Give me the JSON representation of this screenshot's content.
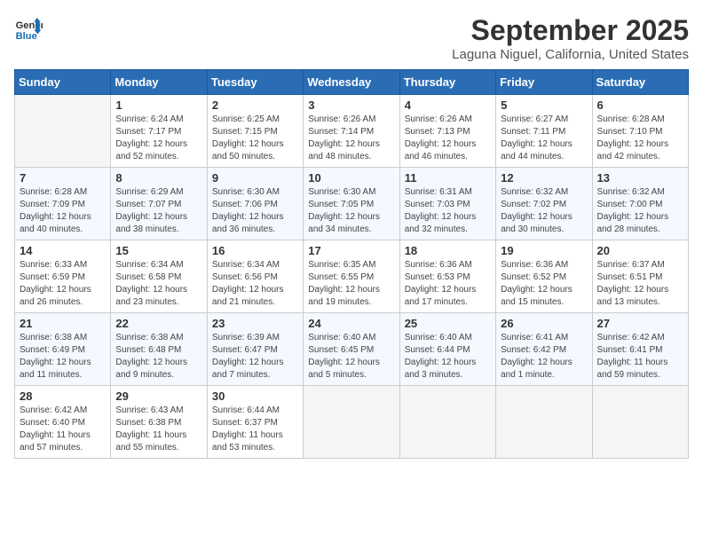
{
  "header": {
    "logo_line1": "General",
    "logo_line2": "Blue",
    "month": "September 2025",
    "location": "Laguna Niguel, California, United States"
  },
  "weekdays": [
    "Sunday",
    "Monday",
    "Tuesday",
    "Wednesday",
    "Thursday",
    "Friday",
    "Saturday"
  ],
  "weeks": [
    [
      {
        "day": null
      },
      {
        "day": "1",
        "sunrise": "6:24 AM",
        "sunset": "7:17 PM",
        "daylight": "12 hours and 52 minutes."
      },
      {
        "day": "2",
        "sunrise": "6:25 AM",
        "sunset": "7:15 PM",
        "daylight": "12 hours and 50 minutes."
      },
      {
        "day": "3",
        "sunrise": "6:26 AM",
        "sunset": "7:14 PM",
        "daylight": "12 hours and 48 minutes."
      },
      {
        "day": "4",
        "sunrise": "6:26 AM",
        "sunset": "7:13 PM",
        "daylight": "12 hours and 46 minutes."
      },
      {
        "day": "5",
        "sunrise": "6:27 AM",
        "sunset": "7:11 PM",
        "daylight": "12 hours and 44 minutes."
      },
      {
        "day": "6",
        "sunrise": "6:28 AM",
        "sunset": "7:10 PM",
        "daylight": "12 hours and 42 minutes."
      }
    ],
    [
      {
        "day": "7",
        "sunrise": "6:28 AM",
        "sunset": "7:09 PM",
        "daylight": "12 hours and 40 minutes."
      },
      {
        "day": "8",
        "sunrise": "6:29 AM",
        "sunset": "7:07 PM",
        "daylight": "12 hours and 38 minutes."
      },
      {
        "day": "9",
        "sunrise": "6:30 AM",
        "sunset": "7:06 PM",
        "daylight": "12 hours and 36 minutes."
      },
      {
        "day": "10",
        "sunrise": "6:30 AM",
        "sunset": "7:05 PM",
        "daylight": "12 hours and 34 minutes."
      },
      {
        "day": "11",
        "sunrise": "6:31 AM",
        "sunset": "7:03 PM",
        "daylight": "12 hours and 32 minutes."
      },
      {
        "day": "12",
        "sunrise": "6:32 AM",
        "sunset": "7:02 PM",
        "daylight": "12 hours and 30 minutes."
      },
      {
        "day": "13",
        "sunrise": "6:32 AM",
        "sunset": "7:00 PM",
        "daylight": "12 hours and 28 minutes."
      }
    ],
    [
      {
        "day": "14",
        "sunrise": "6:33 AM",
        "sunset": "6:59 PM",
        "daylight": "12 hours and 26 minutes."
      },
      {
        "day": "15",
        "sunrise": "6:34 AM",
        "sunset": "6:58 PM",
        "daylight": "12 hours and 23 minutes."
      },
      {
        "day": "16",
        "sunrise": "6:34 AM",
        "sunset": "6:56 PM",
        "daylight": "12 hours and 21 minutes."
      },
      {
        "day": "17",
        "sunrise": "6:35 AM",
        "sunset": "6:55 PM",
        "daylight": "12 hours and 19 minutes."
      },
      {
        "day": "18",
        "sunrise": "6:36 AM",
        "sunset": "6:53 PM",
        "daylight": "12 hours and 17 minutes."
      },
      {
        "day": "19",
        "sunrise": "6:36 AM",
        "sunset": "6:52 PM",
        "daylight": "12 hours and 15 minutes."
      },
      {
        "day": "20",
        "sunrise": "6:37 AM",
        "sunset": "6:51 PM",
        "daylight": "12 hours and 13 minutes."
      }
    ],
    [
      {
        "day": "21",
        "sunrise": "6:38 AM",
        "sunset": "6:49 PM",
        "daylight": "12 hours and 11 minutes."
      },
      {
        "day": "22",
        "sunrise": "6:38 AM",
        "sunset": "6:48 PM",
        "daylight": "12 hours and 9 minutes."
      },
      {
        "day": "23",
        "sunrise": "6:39 AM",
        "sunset": "6:47 PM",
        "daylight": "12 hours and 7 minutes."
      },
      {
        "day": "24",
        "sunrise": "6:40 AM",
        "sunset": "6:45 PM",
        "daylight": "12 hours and 5 minutes."
      },
      {
        "day": "25",
        "sunrise": "6:40 AM",
        "sunset": "6:44 PM",
        "daylight": "12 hours and 3 minutes."
      },
      {
        "day": "26",
        "sunrise": "6:41 AM",
        "sunset": "6:42 PM",
        "daylight": "12 hours and 1 minute."
      },
      {
        "day": "27",
        "sunrise": "6:42 AM",
        "sunset": "6:41 PM",
        "daylight": "11 hours and 59 minutes."
      }
    ],
    [
      {
        "day": "28",
        "sunrise": "6:42 AM",
        "sunset": "6:40 PM",
        "daylight": "11 hours and 57 minutes."
      },
      {
        "day": "29",
        "sunrise": "6:43 AM",
        "sunset": "6:38 PM",
        "daylight": "11 hours and 55 minutes."
      },
      {
        "day": "30",
        "sunrise": "6:44 AM",
        "sunset": "6:37 PM",
        "daylight": "11 hours and 53 minutes."
      },
      {
        "day": null
      },
      {
        "day": null
      },
      {
        "day": null
      },
      {
        "day": null
      }
    ]
  ],
  "labels": {
    "sunrise": "Sunrise:",
    "sunset": "Sunset:",
    "daylight": "Daylight:"
  }
}
